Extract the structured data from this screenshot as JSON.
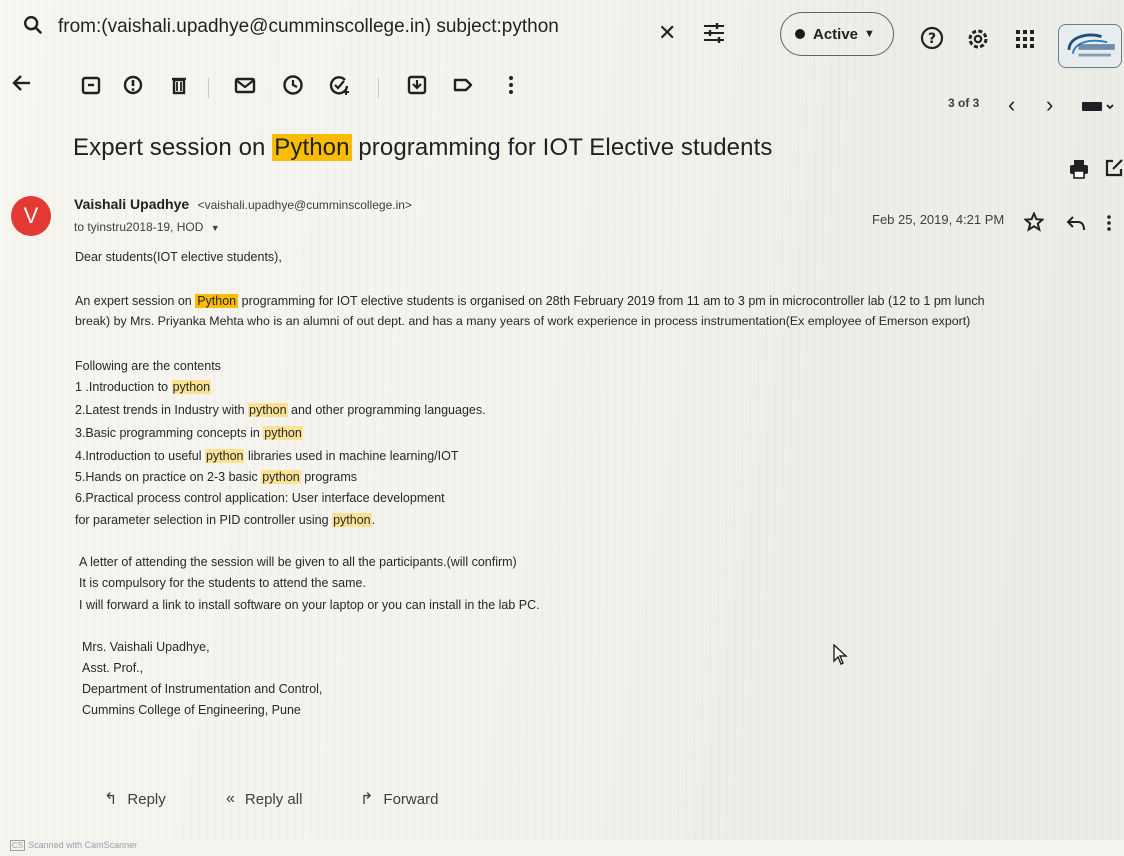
{
  "search": {
    "query": "from:(vaishali.upadhye@cumminscollege.in) subject:python"
  },
  "status": {
    "label": "Active"
  },
  "pager": {
    "text": "3 of 3"
  },
  "email": {
    "subject_before": "Expert session on ",
    "subject_highlight": "Python",
    "subject_after": " programming for IOT Elective students",
    "avatar_letter": "V",
    "sender_name": "Vaishali Upadhye",
    "sender_email": "<vaishali.upadhye@cumminscollege.in>",
    "recipients": "to tyinstru2018-19, HOD",
    "date": "Feb 25, 2019, 4:21 PM",
    "greeting": "Dear students(IOT elective students),",
    "para1_a": "An expert session on ",
    "para1_hl": "Python",
    "para1_b": " programming for IOT elective students is organised on 28th February 2019 from 11 am to 3 pm in microcontroller lab (12 to 1 pm lunch",
    "para1_line2": "break) by Mrs. Priyanka Mehta who is an alumni of out dept. and has a many years of  work experience in process instrumentation(Ex employee of Emerson export)",
    "contents_heading": "Following are the contents",
    "items": [
      {
        "pre": "1 .Introduction to ",
        "hl": "python",
        "post": ""
      },
      {
        "pre": "2.Latest trends in Industry with ",
        "hl": "python",
        "post": " and other programming languages."
      },
      {
        "pre": "3.Basic programming concepts in ",
        "hl": "python",
        "post": ""
      },
      {
        "pre": "4.Introduction to useful ",
        "hl": "python",
        "post": " libraries used in machine learning/IOT"
      },
      {
        "pre": "5.Hands on practice on 2-3 basic ",
        "hl": "python",
        "post": " programs"
      },
      {
        "pre": "6.Practical process control application: User interface development",
        "hl": "",
        "post": ""
      },
      {
        "pre": "for parameter selection in  PID controller using ",
        "hl": "python",
        "post": "."
      }
    ],
    "note1": "A letter of attending the session will be given to all the participants.(will confirm)",
    "note2": "It is compulsory for the students to attend the same.",
    "note3": "I will forward a link to install software on your laptop or you can install in the lab PC.",
    "signature": [
      "Mrs. Vaishali Upadhye,",
      "Asst. Prof.,",
      "Department of Instrumentation and Control,",
      "Cummins College of Engineering, Pune"
    ]
  },
  "actions": {
    "reply": "Reply",
    "reply_all": "Reply all",
    "forward": "Forward"
  },
  "watermark": {
    "badge": "CS",
    "text": "Scanned with CamScanner"
  },
  "colors": {
    "highlight": "#fbbc04",
    "highlight_soft": "#fde293",
    "avatar": "#e53935"
  }
}
